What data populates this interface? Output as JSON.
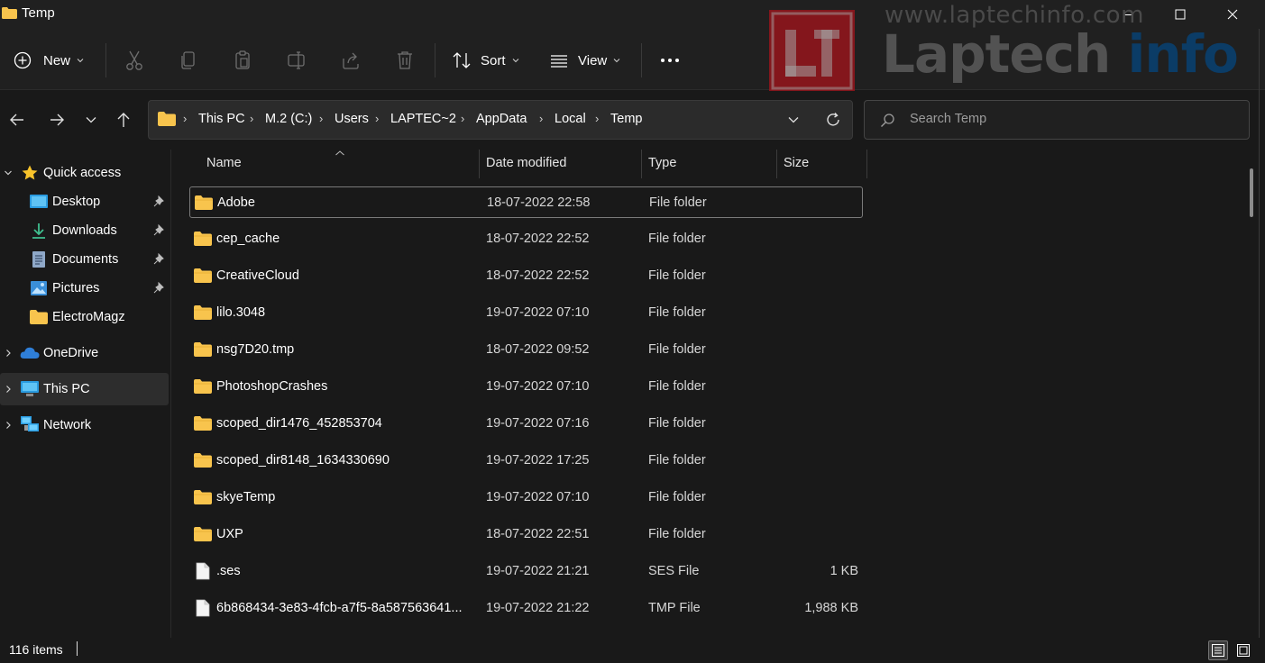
{
  "window": {
    "title": "Temp"
  },
  "toolbar": {
    "new_label": "New",
    "sort_label": "Sort",
    "view_label": "View"
  },
  "address": {
    "crumbs": [
      "This PC",
      "M.2 (C:)",
      "Users",
      "LAPTEC~2",
      "AppData",
      "Local",
      "Temp"
    ]
  },
  "search": {
    "placeholder": "Search Temp"
  },
  "sidebar": {
    "quick_access": "Quick access",
    "items": [
      {
        "label": "Desktop",
        "icon": "desktop-icon",
        "pinned": true
      },
      {
        "label": "Downloads",
        "icon": "download-icon",
        "pinned": true
      },
      {
        "label": "Documents",
        "icon": "document-icon",
        "pinned": true
      },
      {
        "label": "Pictures",
        "icon": "pictures-icon",
        "pinned": true
      },
      {
        "label": "ElectroMagz",
        "icon": "folder-icon",
        "pinned": false
      }
    ],
    "onedrive": "OneDrive",
    "thispc": "This PC",
    "network": "Network"
  },
  "columns": {
    "name": "Name",
    "date": "Date modified",
    "type": "Type",
    "size": "Size"
  },
  "files": [
    {
      "name": "Adobe",
      "date": "18-07-2022 22:58",
      "type": "File folder",
      "size": "",
      "kind": "folder"
    },
    {
      "name": "cep_cache",
      "date": "18-07-2022 22:52",
      "type": "File folder",
      "size": "",
      "kind": "folder"
    },
    {
      "name": "CreativeCloud",
      "date": "18-07-2022 22:52",
      "type": "File folder",
      "size": "",
      "kind": "folder"
    },
    {
      "name": "lilo.3048",
      "date": "19-07-2022 07:10",
      "type": "File folder",
      "size": "",
      "kind": "folder"
    },
    {
      "name": "nsg7D20.tmp",
      "date": "18-07-2022 09:52",
      "type": "File folder",
      "size": "",
      "kind": "folder"
    },
    {
      "name": "PhotoshopCrashes",
      "date": "19-07-2022 07:10",
      "type": "File folder",
      "size": "",
      "kind": "folder"
    },
    {
      "name": "scoped_dir1476_452853704",
      "date": "19-07-2022 07:16",
      "type": "File folder",
      "size": "",
      "kind": "folder"
    },
    {
      "name": "scoped_dir8148_1634330690",
      "date": "19-07-2022 17:25",
      "type": "File folder",
      "size": "",
      "kind": "folder"
    },
    {
      "name": "skyeTemp",
      "date": "19-07-2022 07:10",
      "type": "File folder",
      "size": "",
      "kind": "folder"
    },
    {
      "name": "UXP",
      "date": "18-07-2022 22:51",
      "type": "File folder",
      "size": "",
      "kind": "folder"
    },
    {
      "name": ".ses",
      "date": "19-07-2022 21:21",
      "type": "SES File",
      "size": "1 KB",
      "kind": "file"
    },
    {
      "name": "6b868434-3e83-4fcb-a7f5-8a587563641...",
      "date": "19-07-2022 21:22",
      "type": "TMP File",
      "size": "1,988 KB",
      "kind": "file"
    }
  ],
  "status": {
    "count": "116 items"
  },
  "watermark": {
    "url": "www.laptechinfo.com",
    "name_a": "Laptech",
    "name_b": " info"
  },
  "colors": {
    "folder": "#f8c44d",
    "background": "#191919",
    "chrome": "#202020",
    "onedrive": "#2f7fd8"
  }
}
